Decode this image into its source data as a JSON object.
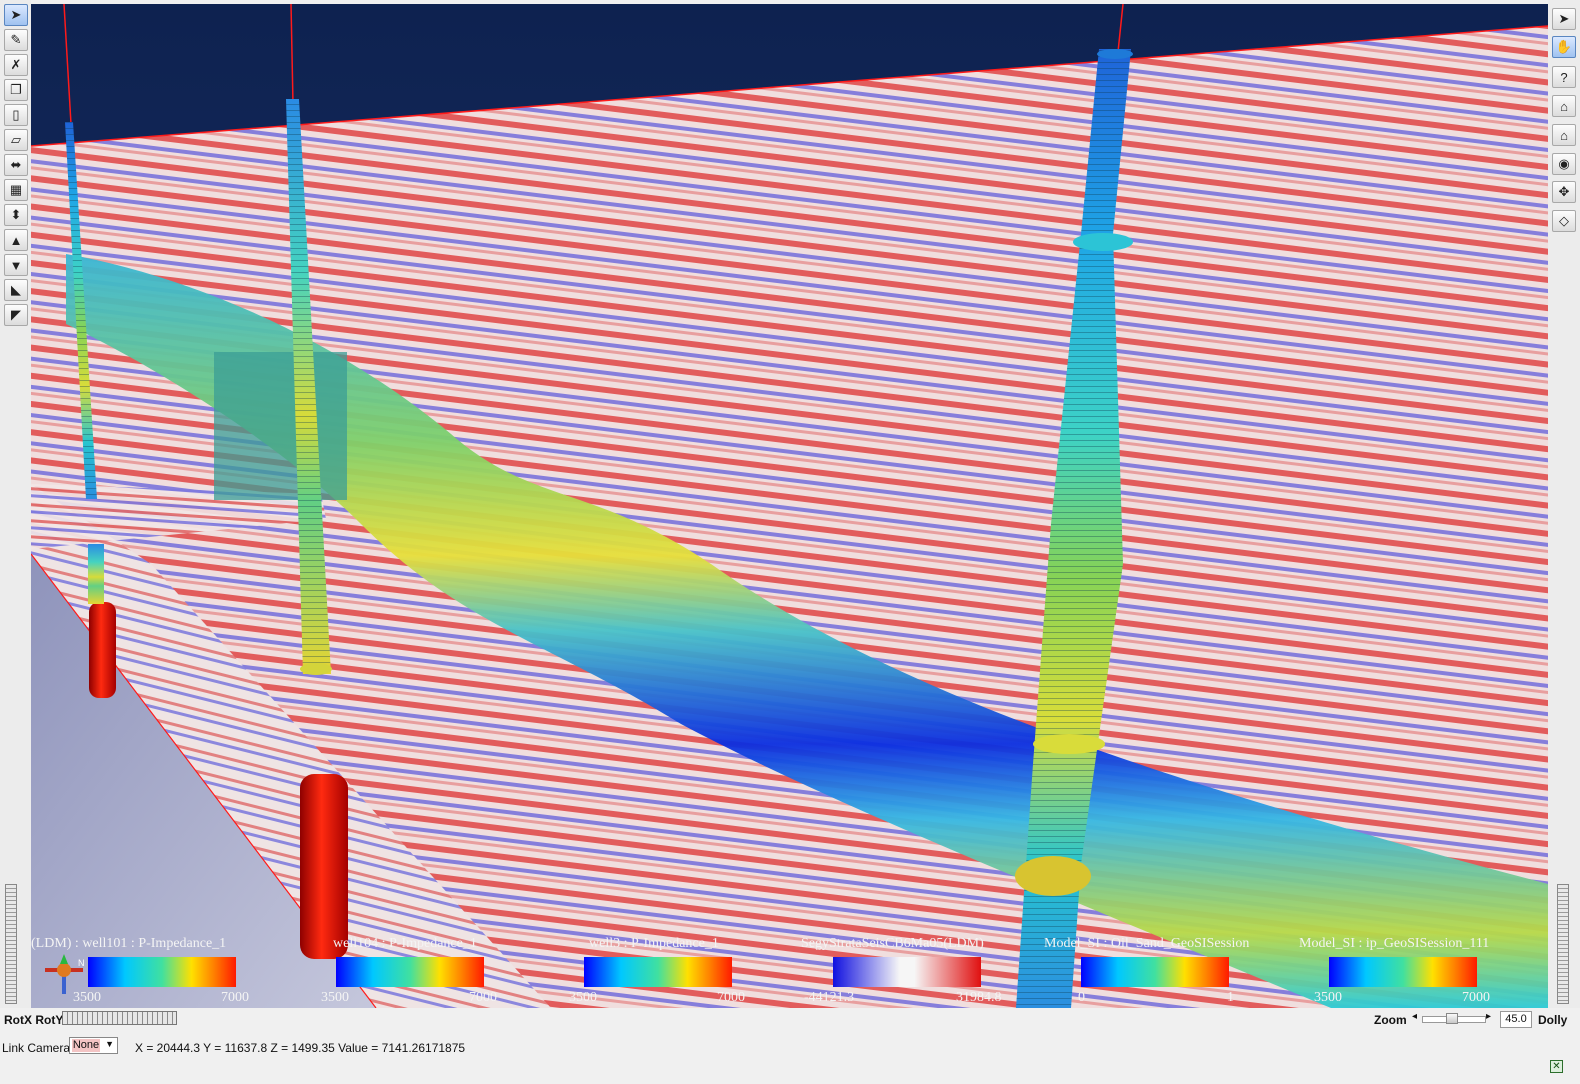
{
  "left_toolbar": {
    "tools": [
      {
        "icon": "select-arrow-icon",
        "active": true
      },
      {
        "icon": "pick-pen-icon"
      },
      {
        "icon": "erase-pick-icon"
      },
      {
        "icon": "layers-icon"
      },
      {
        "icon": "cylinder-icon"
      },
      {
        "icon": "plane-icon"
      },
      {
        "icon": "plane-move-icon"
      },
      {
        "icon": "volume-icon"
      },
      {
        "icon": "volume-move-icon"
      },
      {
        "icon": "well-icon"
      },
      {
        "icon": "well-down-icon"
      },
      {
        "icon": "horizon-icon"
      },
      {
        "icon": "fault-icon"
      }
    ]
  },
  "right_toolbar": {
    "tools": [
      {
        "icon": "pointer-icon",
        "label": ""
      },
      {
        "icon": "hand-icon",
        "label": "",
        "active": true
      },
      {
        "icon": "help-icon",
        "label": "?"
      },
      {
        "icon": "home-icon",
        "label": ""
      },
      {
        "icon": "set-home-icon",
        "label": ""
      },
      {
        "icon": "view-all-icon",
        "label": ""
      },
      {
        "icon": "seek-icon",
        "label": ""
      },
      {
        "icon": "perspective-icon",
        "label": ""
      }
    ]
  },
  "legends": [
    {
      "title": "(LDM) : well101 : P-Impedance_1",
      "min": "3500",
      "max": "7000",
      "colormap": "rainbow"
    },
    {
      "title": "well104 : P-Impedance_1",
      "min": "3500",
      "max": "7000",
      "colormap": "rainbow"
    },
    {
      "title": "well3 : P-Impedance_1",
      "min": "3500",
      "max": "7000",
      "colormap": "rainbow"
    },
    {
      "title": "SegyStrataSeisCB6Ma05(LDM)",
      "min": "-44121.3",
      "max": "31984.8",
      "colormap": "seismic"
    },
    {
      "title": "Model_SI : Oil_Sand_GeoSISession",
      "min": "0",
      "max": "1",
      "colormap": "rainbow"
    },
    {
      "title": "Model_SI : ip_GeoSISession_111",
      "min": "3500",
      "max": "7000",
      "colormap": "rainbow"
    }
  ],
  "colors": {
    "sky_top": "#0e2250",
    "sky_bottom": "#1f3570",
    "seismic_positive": "#d82424",
    "seismic_negative": "#2a2ad8",
    "seismic_neutral": "#f2f2f2",
    "grid_line": "#ff1a1a",
    "ground_plane": "#9ea3c6"
  },
  "bottom_bar": {
    "rot_label": "RotX RotY",
    "zoom_label": "Zoom",
    "zoom_value": "45.0",
    "zoom_left_arrow": "◂",
    "zoom_right_arrow": "▸",
    "dolly_label": "Dolly",
    "link_camera_label": "Link Camera:",
    "link_camera_value": "None",
    "coordinate_readout": "X = 20444.3 Y = 11637.8 Z = 1499.35 Value = 7141.26171875"
  },
  "compass": {
    "north_label": "N"
  }
}
